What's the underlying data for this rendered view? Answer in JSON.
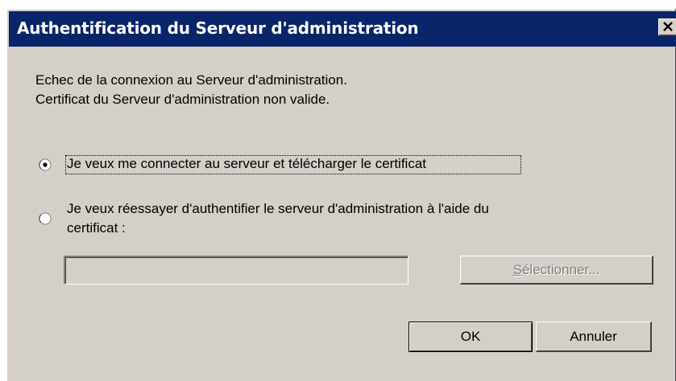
{
  "window": {
    "title": "Authentification du Serveur d'administration"
  },
  "message": {
    "line1": "Echec de la connexion au Serveur d'administration.",
    "line2": "Certificat du Serveur d'administration non valide."
  },
  "options": [
    {
      "label": "Je veux me connecter au serveur et télécharger le certificat",
      "selected": true
    },
    {
      "label_line1": "Je veux réessayer d'authentifier le serveur d'administration à l'aide du",
      "label_line2": "certificat :",
      "selected": false
    }
  ],
  "certificate_field": {
    "value": "",
    "enabled": false
  },
  "buttons": {
    "select_mnemonic": "S",
    "select_rest": "électionner...",
    "ok": "OK",
    "cancel": "Annuler"
  },
  "colors": {
    "titlebar": "#0a246a",
    "face": "#d4d0c8",
    "disabled_text": "#808080"
  }
}
